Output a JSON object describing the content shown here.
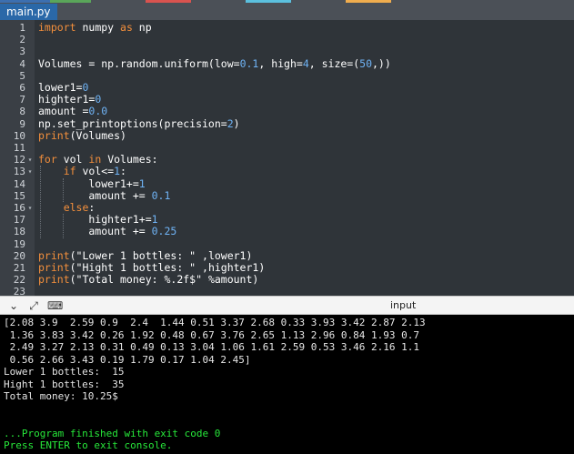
{
  "colors": {
    "editor_bg": "#2f3439",
    "gutter_bg": "#3a3f45",
    "keyword": "#f38f3c",
    "number": "#6fb3f5",
    "tab_active": "#2a68a8",
    "console_green": "#27e83a"
  },
  "tab": {
    "label": "main.py"
  },
  "editor": {
    "lines": [
      {
        "n": "1",
        "code": [
          {
            "t": "import",
            "c": "kw"
          },
          {
            "t": " numpy ",
            "c": ""
          },
          {
            "t": "as",
            "c": "kw"
          },
          {
            "t": " np",
            "c": ""
          }
        ]
      },
      {
        "n": "2",
        "code": []
      },
      {
        "n": "3",
        "code": []
      },
      {
        "n": "4",
        "code": [
          {
            "t": "Volumes = np.random.uniform(low=",
            "c": ""
          },
          {
            "t": "0.1",
            "c": "num"
          },
          {
            "t": ", high=",
            "c": ""
          },
          {
            "t": "4",
            "c": "num"
          },
          {
            "t": ", size=(",
            "c": ""
          },
          {
            "t": "50",
            "c": "num"
          },
          {
            "t": ",))",
            "c": ""
          }
        ]
      },
      {
        "n": "5",
        "code": []
      },
      {
        "n": "6",
        "code": [
          {
            "t": "lower1=",
            "c": ""
          },
          {
            "t": "0",
            "c": "num"
          }
        ]
      },
      {
        "n": "7",
        "code": [
          {
            "t": "highter1=",
            "c": ""
          },
          {
            "t": "0",
            "c": "num"
          }
        ]
      },
      {
        "n": "8",
        "code": [
          {
            "t": "amount =",
            "c": ""
          },
          {
            "t": "0.0",
            "c": "num"
          }
        ]
      },
      {
        "n": "9",
        "code": [
          {
            "t": "np.set_printoptions(precision=",
            "c": ""
          },
          {
            "t": "2",
            "c": "num"
          },
          {
            "t": ")",
            "c": ""
          }
        ]
      },
      {
        "n": "10",
        "code": [
          {
            "t": "print",
            "c": "fn"
          },
          {
            "t": "(Volumes)",
            "c": ""
          }
        ]
      },
      {
        "n": "11",
        "code": []
      },
      {
        "n": "12",
        "fold": true,
        "code": [
          {
            "t": "for",
            "c": "kw"
          },
          {
            "t": " vol ",
            "c": ""
          },
          {
            "t": "in",
            "c": "kw"
          },
          {
            "t": " Volumes:",
            "c": ""
          }
        ]
      },
      {
        "n": "13",
        "fold": true,
        "code": [
          {
            "t": "    ",
            "c": ""
          },
          {
            "t": "if",
            "c": "kw"
          },
          {
            "t": " vol<=",
            "c": ""
          },
          {
            "t": "1",
            "c": "num"
          },
          {
            "t": ":",
            "c": ""
          }
        ]
      },
      {
        "n": "14",
        "code": [
          {
            "t": "        lower1+=",
            "c": ""
          },
          {
            "t": "1",
            "c": "num"
          }
        ]
      },
      {
        "n": "15",
        "code": [
          {
            "t": "        amount += ",
            "c": ""
          },
          {
            "t": "0.1",
            "c": "num"
          }
        ]
      },
      {
        "n": "16",
        "fold": true,
        "code": [
          {
            "t": "    ",
            "c": ""
          },
          {
            "t": "else",
            "c": "kw"
          },
          {
            "t": ":",
            "c": ""
          }
        ]
      },
      {
        "n": "17",
        "code": [
          {
            "t": "        highter1+=",
            "c": ""
          },
          {
            "t": "1",
            "c": "num"
          }
        ]
      },
      {
        "n": "18",
        "code": [
          {
            "t": "        amount += ",
            "c": ""
          },
          {
            "t": "0.25",
            "c": "num"
          }
        ]
      },
      {
        "n": "19",
        "code": []
      },
      {
        "n": "20",
        "code": [
          {
            "t": "print",
            "c": "fn"
          },
          {
            "t": "(\"Lower 1 bottles: \" ,lower1)",
            "c": ""
          }
        ]
      },
      {
        "n": "21",
        "code": [
          {
            "t": "print",
            "c": "fn"
          },
          {
            "t": "(\"Hight 1 bottles: \" ,highter1)",
            "c": ""
          }
        ]
      },
      {
        "n": "22",
        "code": [
          {
            "t": "print",
            "c": "fn"
          },
          {
            "t": "(\"Total money: %.2f$\" %amount)",
            "c": ""
          }
        ]
      },
      {
        "n": "23",
        "code": []
      }
    ]
  },
  "console_bar": {
    "label": "input",
    "icons": [
      "chevron-down-icon",
      "expand-icon",
      "stdin-icon"
    ]
  },
  "console": {
    "lines": [
      {
        "t": "[2.08 3.9  2.59 0.9  2.4  1.44 0.51 3.37 2.68 0.33 3.93 3.42 2.87 2.13",
        "c": ""
      },
      {
        "t": " 1.36 3.83 3.42 0.26 1.92 0.48 0.67 3.76 2.65 1.13 2.96 0.84 1.93 0.7",
        "c": ""
      },
      {
        "t": " 2.49 3.27 2.13 0.31 0.49 0.13 3.04 1.06 1.61 2.59 0.53 3.46 2.16 1.1",
        "c": ""
      },
      {
        "t": " 0.56 2.66 3.43 0.19 1.79 0.17 1.04 2.45]",
        "c": ""
      },
      {
        "t": "Lower 1 bottles:  15",
        "c": ""
      },
      {
        "t": "Hight 1 bottles:  35",
        "c": ""
      },
      {
        "t": "Total money: 10.25$",
        "c": ""
      },
      {
        "t": "",
        "c": ""
      },
      {
        "t": "",
        "c": ""
      },
      {
        "t": "...Program finished with exit code 0",
        "c": "green"
      },
      {
        "t": "Press ENTER to exit console.",
        "c": "green"
      }
    ]
  }
}
